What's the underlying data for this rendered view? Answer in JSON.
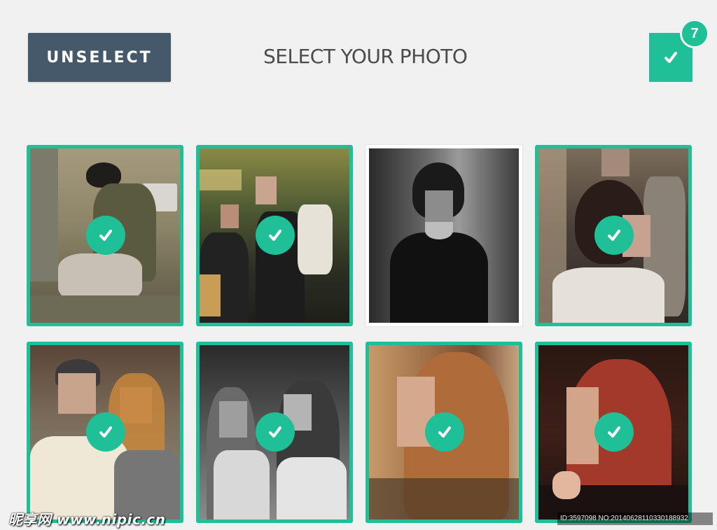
{
  "header": {
    "unselect_label": "UNSELECT",
    "title": "SELECT YOUR PHOTO",
    "selected_count": "7"
  },
  "colors": {
    "accent": "#1fbf97",
    "button": "#46596a",
    "background": "#f1f1f1"
  },
  "icons": {
    "counter": "check-icon",
    "tile": "check-icon"
  },
  "photos": [
    {
      "id": "photo-1",
      "selected": true
    },
    {
      "id": "photo-2",
      "selected": true
    },
    {
      "id": "photo-3",
      "selected": false
    },
    {
      "id": "photo-4",
      "selected": true
    },
    {
      "id": "photo-5",
      "selected": true
    },
    {
      "id": "photo-6",
      "selected": true
    },
    {
      "id": "photo-7",
      "selected": true
    },
    {
      "id": "photo-8",
      "selected": true
    }
  ],
  "watermark": {
    "left": "昵享网 www.nipic.cn",
    "right": "ID:3597098 NO:20140628110330188932"
  }
}
